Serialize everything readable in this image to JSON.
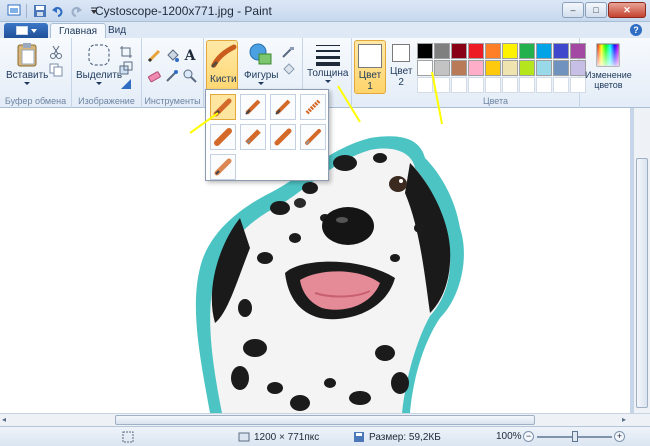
{
  "window": {
    "title": "Cystoscope-1200x771.jpg - Paint",
    "controls": [
      "–",
      "□",
      "✕"
    ]
  },
  "tabs": [
    {
      "label": "Главная",
      "active": true
    },
    {
      "label": "Вид",
      "active": false
    }
  ],
  "ribbon": {
    "clipboard": {
      "paste": "Вставить",
      "group": "Буфер обмена"
    },
    "image": {
      "select": "Выделить",
      "group": "Изображение"
    },
    "tools": {
      "group": "Инструменты"
    },
    "brushes": {
      "label": "Кисти"
    },
    "shapes": {
      "label": "Фигуры"
    },
    "thickness": {
      "label": "Толщина"
    },
    "color1": {
      "label": "Цвет",
      "number": "1",
      "value": "#ffffff"
    },
    "color2": {
      "label": "Цвет",
      "number": "2",
      "value": "#ffffff"
    },
    "colors_group": "Цвета",
    "edit_colors": {
      "line1": "Изменение",
      "line2": "цветов"
    },
    "palette": [
      "#000000",
      "#7f7f7f",
      "#880015",
      "#ed1c24",
      "#ff7f27",
      "#fff200",
      "#22b14c",
      "#00a2e8",
      "#3f48cc",
      "#a349a4",
      "#ffffff",
      "#c3c3c3",
      "#b97a57",
      "#ffaec9",
      "#ffc90e",
      "#efe4b0",
      "#b5e61d",
      "#99d9ea",
      "#7092be",
      "#c8bfe7"
    ]
  },
  "brush_popup_count": 9,
  "statusbar": {
    "dimensions": "1200 × 771пкс",
    "size": "Размер: 59,2КБ",
    "zoom": "100%",
    "zoom_level": 0.5
  },
  "colors": {
    "accent": "#2f6dc2",
    "annotation": "#ffff00",
    "selection": "#ffd46a",
    "outline": "#4cc4c4"
  }
}
